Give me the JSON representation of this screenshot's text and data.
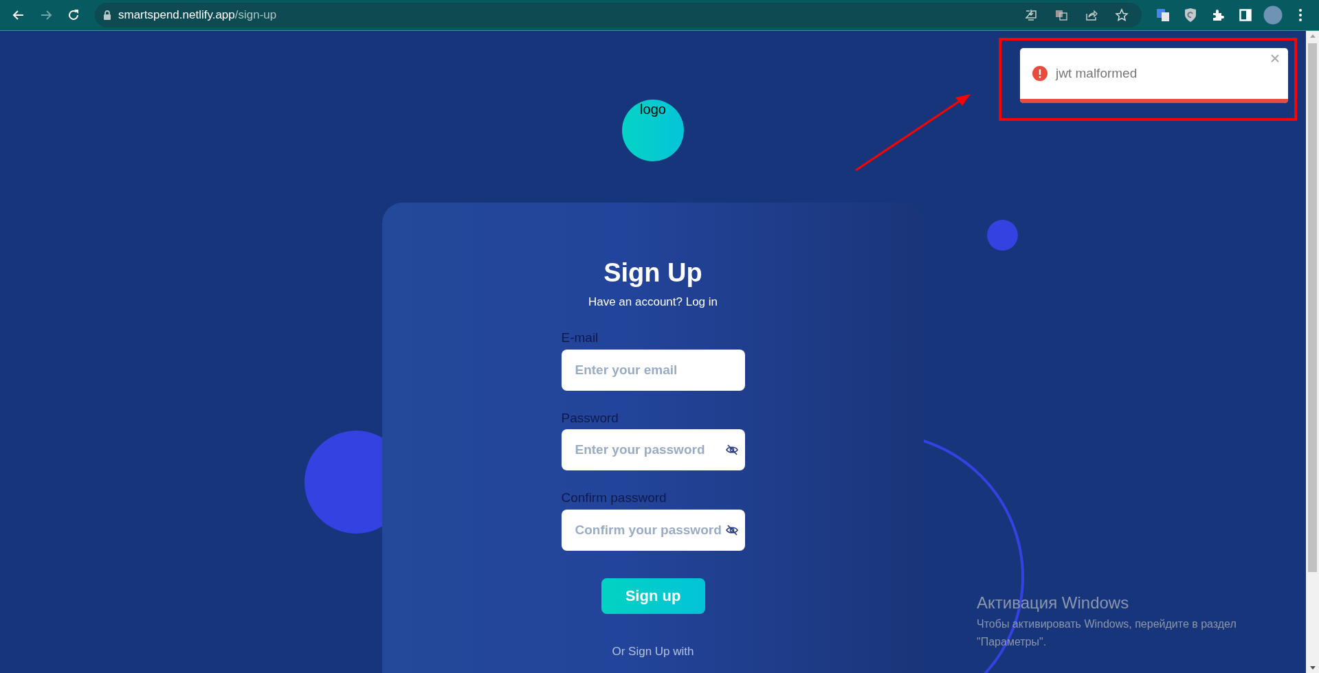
{
  "browser": {
    "url_host": "smartspend.netlify.app",
    "url_path": "/sign-up",
    "forward_disabled": true
  },
  "toast": {
    "kind": "error",
    "message": "jwt malformed",
    "level": 1
  },
  "logo": {
    "alt": "logo"
  },
  "form": {
    "title": "Sign Up",
    "subtitle": "Have an account? Log in",
    "fields": [
      {
        "kind": "email",
        "label": "E-mail",
        "placeholder": "Enter your email"
      },
      {
        "kind": "password",
        "label": "Password",
        "placeholder": "Enter your password"
      },
      {
        "kind": "password",
        "label": "Confirm password",
        "placeholder": "Confirm your password"
      }
    ],
    "submit": "Sign up",
    "alt_text": "Or Sign Up with"
  },
  "os_notice": {
    "title": "Активация Windows",
    "lines": [
      "Чтобы активировать Windows, перейдите в раздел",
      "\"Параметры\"."
    ]
  }
}
